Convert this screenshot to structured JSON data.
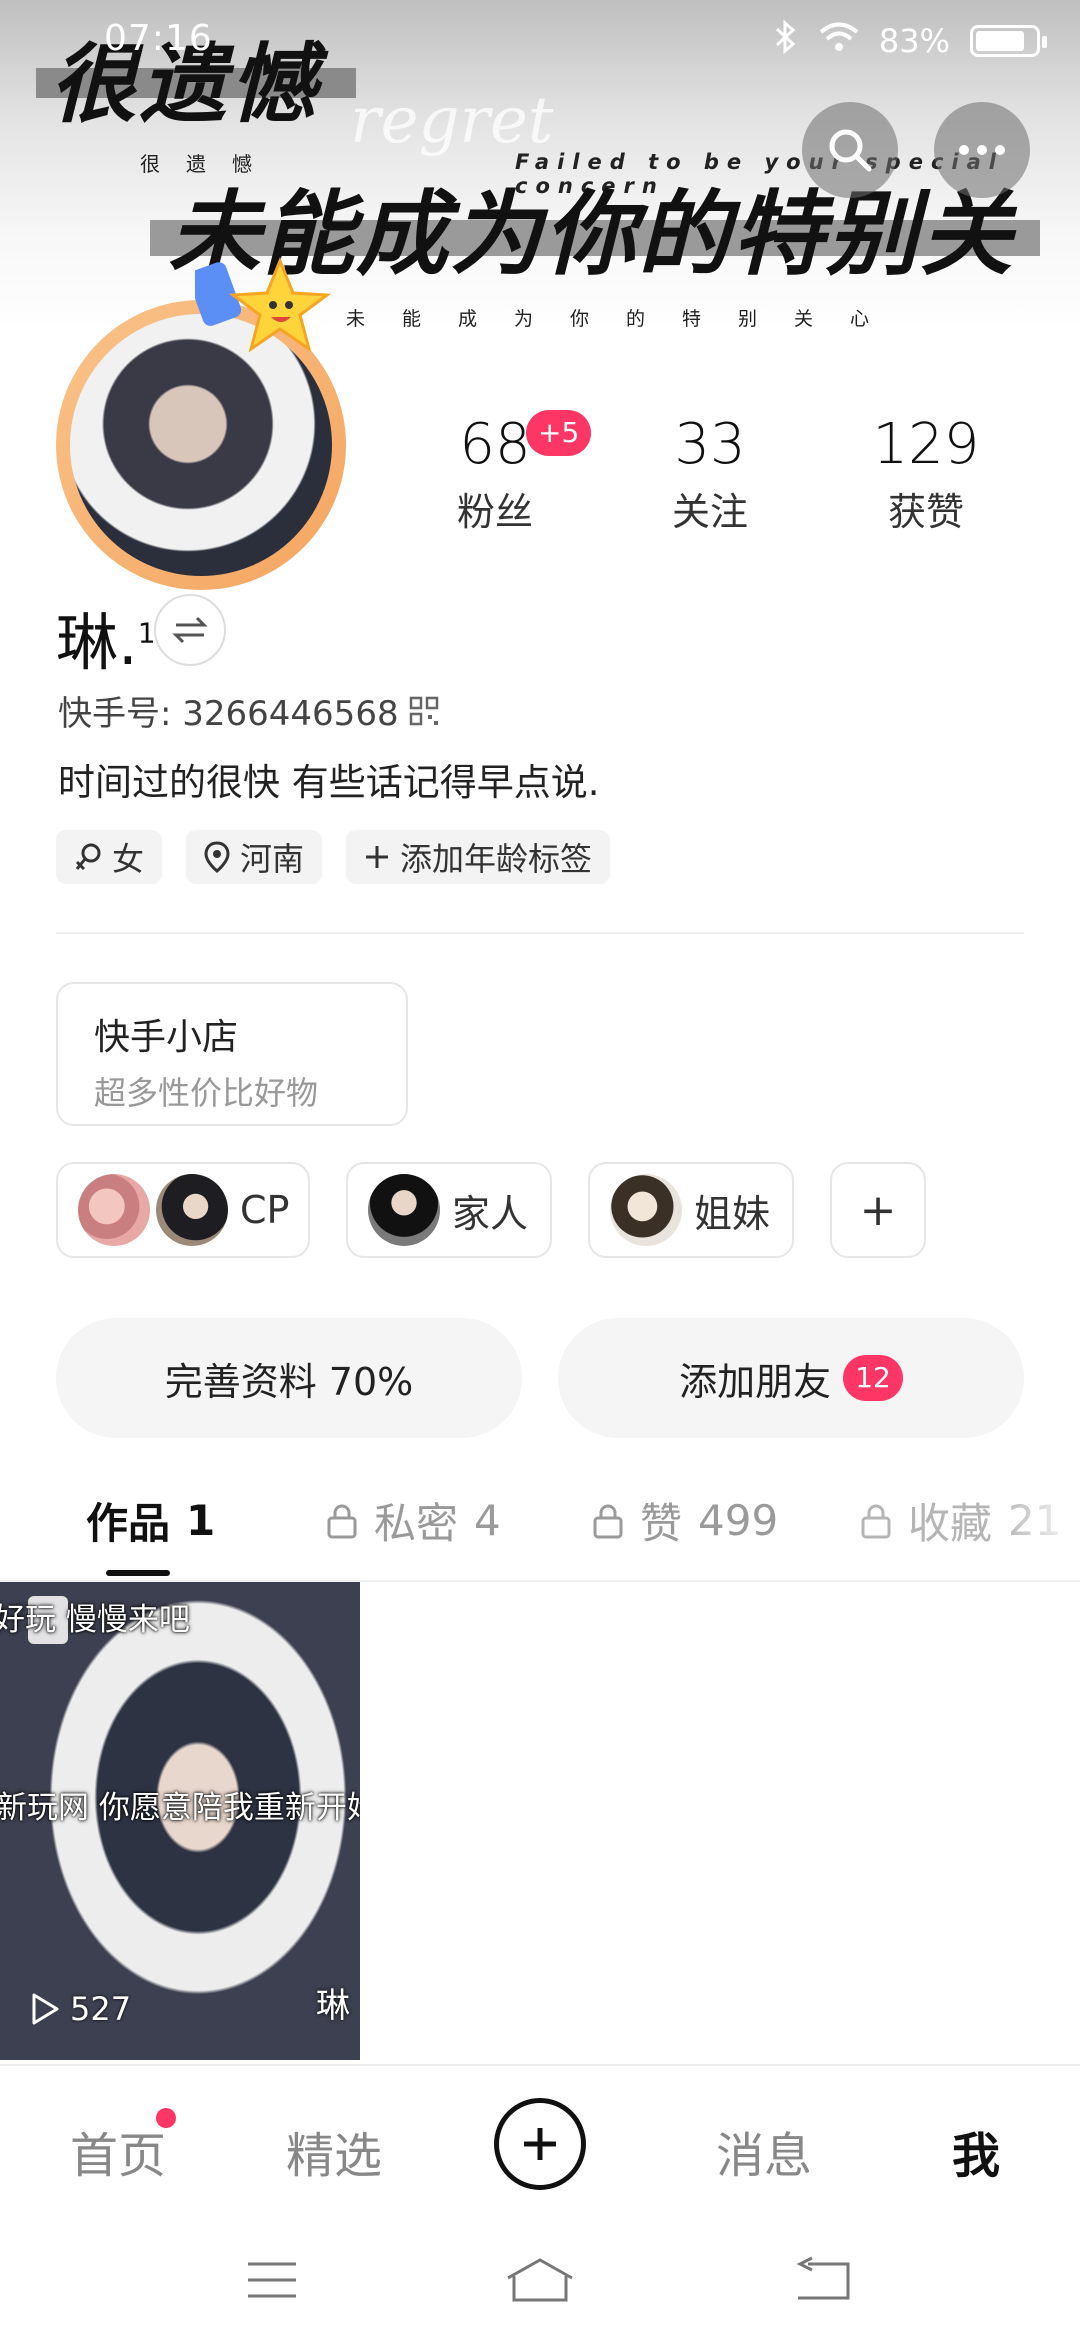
{
  "status_bar": {
    "time": "07:16",
    "battery_text": "83%",
    "battery_level": 0.83
  },
  "banner": {
    "title1": "很遗憾",
    "subtitle1": "很遗憾",
    "en_word": "regret",
    "en_line": "Failed to be your special concern",
    "title2": "未能成为你的特别关心",
    "subtitle2": "未能成为你的特别关心"
  },
  "header_buttons": {
    "search_icon": "search-icon",
    "more_icon": "more-dots-icon"
  },
  "stats": {
    "fans": {
      "value": "68",
      "label": "粉丝",
      "badge": "+5"
    },
    "following": {
      "value": "33",
      "label": "关注"
    },
    "likes": {
      "value": "129",
      "label": "获赞"
    }
  },
  "profile": {
    "name": "琳.",
    "name_sup": "1",
    "kuaishou_id": "快手号: 3266446568",
    "bio": "时间过的很快  有些话记得早点说.",
    "tags": [
      {
        "icon": "female-icon",
        "label": "女"
      },
      {
        "icon": "location-icon",
        "label": "河南"
      },
      {
        "icon": "plus-icon",
        "label": "添加年龄标签"
      }
    ]
  },
  "shop": {
    "title": "快手小店",
    "subtitle": "超多性价比好物"
  },
  "groups": [
    {
      "label": "CP"
    },
    {
      "label": "家人"
    },
    {
      "label": "姐妹"
    },
    {
      "label": "+"
    }
  ],
  "actions": {
    "complete_profile": "完善资料 70%",
    "add_friends": "添加朋友",
    "add_friends_badge": "12"
  },
  "tabs": [
    {
      "label": "作品",
      "count": "1",
      "locked": false,
      "active": true
    },
    {
      "label": "私密",
      "count": "4",
      "locked": true
    },
    {
      "label": "赞",
      "count": "499",
      "locked": true
    },
    {
      "label": "收藏",
      "count": "21",
      "locked": true
    }
  ],
  "video": {
    "caption_top": "好玩 慢慢来吧",
    "caption_mid": "新玩网 你愿意陪我重新开始吗？",
    "watermark": "琳",
    "plays": "527"
  },
  "bottom_nav": {
    "home": "首页",
    "featured": "精选",
    "messages": "消息",
    "me": "我"
  },
  "colors": {
    "accent": "#fe3666",
    "avatar_ring": "#f5a560"
  }
}
